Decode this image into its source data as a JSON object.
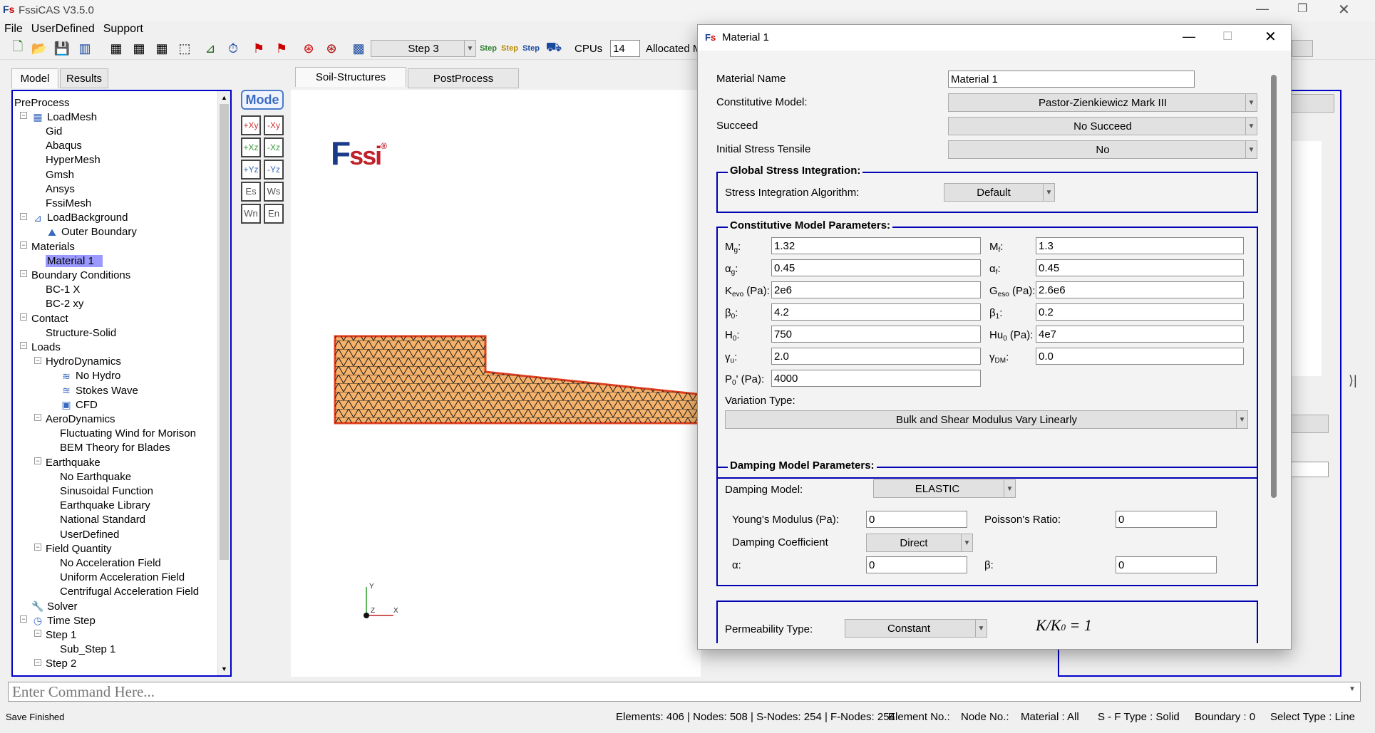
{
  "app": {
    "title": "FssiCAS V3.5.0"
  },
  "menu": [
    "File",
    "UserDefined",
    "Support"
  ],
  "toolbar": {
    "step_select": "Step 3",
    "cpus_label": "CPUs",
    "cpus_value": "14",
    "allocated_label": "Allocated M"
  },
  "left_tabs": [
    "Model",
    "Results"
  ],
  "center_tabs": [
    "Soil-Structures",
    "PostProcess"
  ],
  "tree": [
    {
      "label": "PreProcess",
      "level": 0
    },
    {
      "label": "LoadMesh",
      "level": 1
    },
    {
      "label": "Gid",
      "level": 2
    },
    {
      "label": "Abaqus",
      "level": 2
    },
    {
      "label": "HyperMesh",
      "level": 2
    },
    {
      "label": "Gmsh",
      "level": 2
    },
    {
      "label": "Ansys",
      "level": 2
    },
    {
      "label": "FssiMesh",
      "level": 2
    },
    {
      "label": "LoadBackground",
      "level": 1
    },
    {
      "label": "Outer Boundary",
      "level": 2
    },
    {
      "label": "Materials",
      "level": 1
    },
    {
      "label": "Material 1",
      "level": 2
    },
    {
      "label": "Boundary Conditions",
      "level": 1
    },
    {
      "label": "BC-1 X",
      "level": 2
    },
    {
      "label": "BC-2 xy",
      "level": 2
    },
    {
      "label": "Contact",
      "level": 1
    },
    {
      "label": "Structure-Solid",
      "level": 2
    },
    {
      "label": "Loads",
      "level": 1
    },
    {
      "label": "HydroDynamics",
      "level": 2
    },
    {
      "label": "No Hydro",
      "level": 3
    },
    {
      "label": "Stokes Wave",
      "level": 3
    },
    {
      "label": "CFD",
      "level": 3
    },
    {
      "label": "AeroDynamics",
      "level": 2
    },
    {
      "label": "Fluctuating Wind for Morison",
      "level": 3
    },
    {
      "label": "BEM Theory for Blades",
      "level": 3
    },
    {
      "label": "Earthquake",
      "level": 2
    },
    {
      "label": "No Earthquake",
      "level": 3
    },
    {
      "label": "Sinusoidal Function",
      "level": 3
    },
    {
      "label": "Earthquake Library",
      "level": 3
    },
    {
      "label": "National Standard",
      "level": 3
    },
    {
      "label": "UserDefined",
      "level": 3
    },
    {
      "label": "Field Quantity",
      "level": 2
    },
    {
      "label": "No Acceleration Field",
      "level": 3
    },
    {
      "label": "Uniform Acceleration Field",
      "level": 3
    },
    {
      "label": "Centrifugal Acceleration Field",
      "level": 3
    },
    {
      "label": "Solver",
      "level": 1
    },
    {
      "label": "Time Step",
      "level": 1
    },
    {
      "label": "Step 1",
      "level": 2
    },
    {
      "label": "Sub_Step 1",
      "level": 3
    },
    {
      "label": "Step 2",
      "level": 2
    }
  ],
  "canvas": {
    "mode_label": "Mode",
    "logo_text": "Fssi",
    "axis_y": "Y",
    "axis_x": "X",
    "axis_z": "Z"
  },
  "dialog": {
    "title": "Material 1",
    "material_name_label": "Material Name",
    "material_name": "Material 1",
    "constitutive_label": "Constitutive Model:",
    "constitutive_value": "Pastor-Zienkiewicz Mark III",
    "succeed_label": "Succeed",
    "succeed_value": "No Succeed",
    "initial_stress_label": "Initial Stress Tensile",
    "initial_stress_value": "No",
    "global_group": "Global Stress Integration:",
    "stress_alg_label": "Stress Integration Algorithm:",
    "stress_alg_value": "Default",
    "params_group": "Constitutive Model Parameters:",
    "p": {
      "mg": "1.32",
      "mf": "1.3",
      "ag": "0.45",
      "af": "0.45",
      "kevo": "2e6",
      "geso": "2.6e6",
      "b0": "4.2",
      "b1": "0.2",
      "h0": "750",
      "hu0": "4e7",
      "yu": "2.0",
      "ydm": "0.0",
      "p0": "4000"
    },
    "variation_label": "Variation Type:",
    "variation_value": "Bulk and Shear Modulus Vary Linearly",
    "damping_group": "Damping Model Parameters:",
    "damping_model_label": "Damping Model:",
    "damping_model_value": "ELASTIC",
    "young_label": "Young's Modulus (Pa):",
    "young_value": "0",
    "poisson_label": "Poisson's Ratio:",
    "poisson_value": "0",
    "damp_coef_label": "Damping Coefficient",
    "damp_coef_value": "Direct",
    "alpha_label": "α:",
    "alpha_value": "0",
    "beta_label": "β:",
    "beta_value": "0",
    "perm_label": "Permeability Type:",
    "perm_value": "Constant"
  },
  "command_placeholder": "Enter Command Here...",
  "status": {
    "left": "Save Finished",
    "right": "Elements: 406 | Nodes: 508 | S-Nodes: 254 | F-Nodes: 254",
    "element_no": "Element No.:",
    "node_no": "Node No.:",
    "material": "Material :  All",
    "sf_type": "S - F Type :  Solid",
    "boundary": "Boundary :  0",
    "select_type": "Select Type :  Line"
  },
  "colors": {
    "accent": "#0000c8",
    "selection": "#9999ff",
    "mesh": "#f5b26b"
  }
}
